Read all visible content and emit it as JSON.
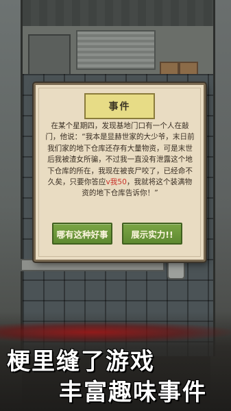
{
  "event_dialog": {
    "title": "事件",
    "body_before_highlight": "在某个星期四，发现基地门口有一个人在敲门，他说：“我本是显赫世家的大少爷，末日前我们家的地下仓库还存有大量物资，可是末世后我被渣女所骗，不过我一直没有泄露这个地下仓库的所在，我现在被丧尸咬了，已经命不久矣，只要你答应",
    "body_highlight": "v我50",
    "body_after_highlight": "，我就将这个装满物资的地下仓库告诉你！”",
    "highlight_color": "#c8322a",
    "buttons": {
      "decline_label": "哪有这种好事",
      "accept_label": "展示实力!!"
    },
    "button_color": "#6b9639"
  },
  "promo": {
    "line1": "梗里缝了游戏",
    "line2": "丰富趣味事件"
  }
}
